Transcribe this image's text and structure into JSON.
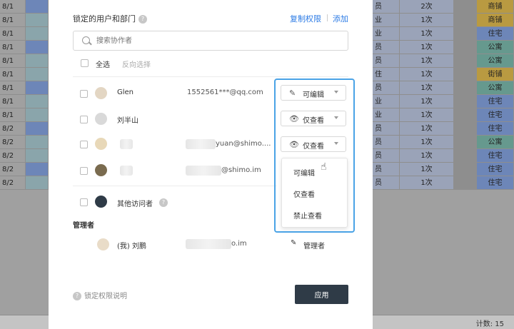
{
  "sheet": {
    "rows": [
      {
        "date": "8/1",
        "left": "员",
        "count": "2次",
        "type": "商铺",
        "typeColor": "#b99a41"
      },
      {
        "date": "8/1",
        "left": "业",
        "count": "1次",
        "type": "商铺",
        "typeColor": "#b99a41"
      },
      {
        "date": "8/1",
        "left": "业",
        "count": "1次",
        "type": "住宅",
        "typeColor": "#6d86b8"
      },
      {
        "date": "8/1",
        "left": "员",
        "count": "1次",
        "type": "公寓",
        "typeColor": "#66998e"
      },
      {
        "date": "8/1",
        "left": "员",
        "count": "1次",
        "type": "公寓",
        "typeColor": "#66998e"
      },
      {
        "date": "8/1",
        "left": "住",
        "count": "1次",
        "type": "街铺",
        "typeColor": "#b99a41"
      },
      {
        "date": "8/1",
        "left": "员",
        "count": "1次",
        "type": "公寓",
        "typeColor": "#66998e"
      },
      {
        "date": "8/1",
        "left": "业",
        "count": "1次",
        "type": "住宅",
        "typeColor": "#6d86b8"
      },
      {
        "date": "8/1",
        "left": "业",
        "count": "1次",
        "type": "住宅",
        "typeColor": "#6d86b8"
      },
      {
        "date": "8/2",
        "left": "员",
        "count": "1次",
        "type": "住宅",
        "typeColor": "#6d86b8"
      },
      {
        "date": "8/2",
        "left": "员",
        "count": "1次",
        "type": "公寓",
        "typeColor": "#66998e"
      },
      {
        "date": "8/2",
        "left": "员",
        "count": "1次",
        "type": "住宅",
        "typeColor": "#6d86b8"
      },
      {
        "date": "8/2",
        "left": "员",
        "count": "1次",
        "type": "住宅",
        "typeColor": "#6d86b8"
      },
      {
        "date": "8/2",
        "left": "员",
        "count": "1次",
        "type": "住宅",
        "typeColor": "#6d86b8"
      }
    ],
    "status_count": "计数: 15"
  },
  "modal": {
    "section_title": "锁定的用户和部门",
    "copy_link": "复制权限",
    "add_link": "添加",
    "search_placeholder": "搜索协作者",
    "select_all": "全选",
    "invert_select": "反向选择",
    "users": [
      {
        "name": "Glen",
        "email": "1552561***@qq.com",
        "perm": "可编辑",
        "perm_icon": "pencil-icon"
      },
      {
        "name": "刘半山",
        "email": "",
        "perm": "仅查看",
        "perm_icon": "eye-icon"
      },
      {
        "name": "",
        "email": "yuan@shimo....",
        "perm": "仅查看",
        "perm_icon": "eye-icon"
      },
      {
        "name": "",
        "email": "@shimo.im",
        "perm": "",
        "perm_icon": ""
      }
    ],
    "other_visitors": "其他访问者",
    "dropdown_options": [
      "可编辑",
      "仅查看",
      "禁止查看"
    ],
    "admin_section": "管理者",
    "admin_name": "(我) 刘鹏",
    "admin_email": "o.im",
    "admin_role": "管理者",
    "footer_help": "锁定权限说明",
    "apply_button": "应用",
    "colors": {
      "accent": "#2c7be5",
      "highlight": "#4aa3e6",
      "apply_bg": "#2f3b47"
    }
  }
}
